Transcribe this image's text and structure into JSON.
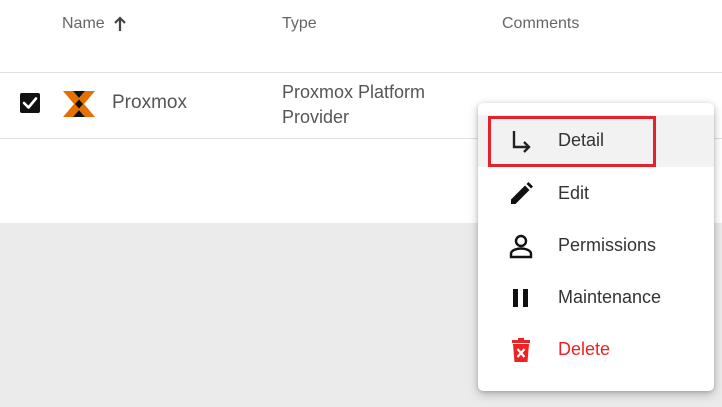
{
  "table": {
    "columns": {
      "name": "Name",
      "type": "Type",
      "comments": "Comments"
    },
    "sort": {
      "column": "Name",
      "direction": "ascending",
      "icon": "arrow-up-icon"
    },
    "rows": [
      {
        "selected": true,
        "icon": "proxmox-logo",
        "name": "Proxmox",
        "type_line1": "Proxmox Platform",
        "type_line2": "Provider",
        "comments": ""
      }
    ]
  },
  "context_menu": {
    "items": [
      {
        "label": "Detail",
        "icon": "subdirectory-arrow-icon",
        "highlighted": true
      },
      {
        "label": "Edit",
        "icon": "pencil-icon"
      },
      {
        "label": "Permissions",
        "icon": "person-icon"
      },
      {
        "label": "Maintenance",
        "icon": "pause-icon"
      },
      {
        "label": "Delete",
        "icon": "trash-icon",
        "color": "#ee2222"
      }
    ]
  },
  "colors": {
    "danger": "#ee2222",
    "highlight_border": "#e5212c",
    "proxmox_orange": "#e57000",
    "empty_area": "#ebebeb"
  }
}
